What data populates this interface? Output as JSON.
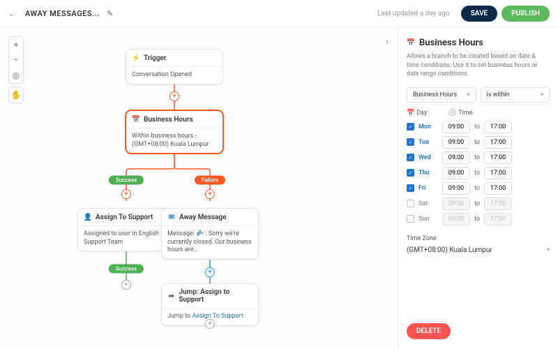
{
  "header": {
    "title": "AWAY MESSAGES...",
    "updated": "Last updated a day ago",
    "save": "SAVE",
    "publish": "PUBLISH"
  },
  "nodes": {
    "trigger": {
      "title": "Trigger",
      "body": "Conversation Opened"
    },
    "hours": {
      "title": "Business Hours",
      "body": "Within business hours - (GMT+08:00) Kuala Lumpur"
    },
    "assign": {
      "title": "Assign To Support",
      "body": "Assigned to user in English Support Team"
    },
    "away": {
      "title": "Away Message",
      "body": "Message: 💤 : Sorry we're currently closed. Our business hours are…"
    },
    "jump": {
      "title": "Jump: Assign to Support",
      "body_pre": "Jump to ",
      "body_link": "Assign To Support"
    }
  },
  "pills": {
    "success": "Success",
    "failure": "Failure"
  },
  "panel": {
    "title": "Business Hours",
    "desc": "Allows a branch to be created based on date & time conditions. Use it to set business hours or date range conditions.",
    "type": "Business Hours",
    "operator": "is within",
    "day_h": "Day",
    "time_h": "Time",
    "to": "to",
    "tz_label": "Time Zone",
    "tz_value": "(GMT+08:00) Kuala Lumpur",
    "delete": "DELETE",
    "days": [
      {
        "name": "Mon",
        "on": true,
        "from": "09:00",
        "to": "17:00"
      },
      {
        "name": "Tue",
        "on": true,
        "from": "09:00",
        "to": "17:00"
      },
      {
        "name": "Wed",
        "on": true,
        "from": "09:00",
        "to": "17:00"
      },
      {
        "name": "Thu",
        "on": true,
        "from": "09:00",
        "to": "17:00"
      },
      {
        "name": "Fri",
        "on": true,
        "from": "09:00",
        "to": "17:00"
      },
      {
        "name": "Sat",
        "on": false,
        "from": "09:00",
        "to": "17:00"
      },
      {
        "name": "Sun",
        "on": false,
        "from": "09:00",
        "to": "17:00"
      }
    ]
  }
}
